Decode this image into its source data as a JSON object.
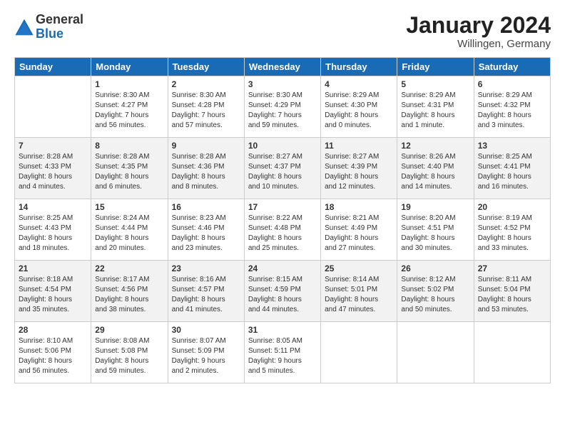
{
  "logo": {
    "general": "General",
    "blue": "Blue"
  },
  "header": {
    "title": "January 2024",
    "subtitle": "Willingen, Germany"
  },
  "days_of_week": [
    "Sunday",
    "Monday",
    "Tuesday",
    "Wednesday",
    "Thursday",
    "Friday",
    "Saturday"
  ],
  "weeks": [
    [
      {
        "day": "",
        "info": ""
      },
      {
        "day": "1",
        "info": "Sunrise: 8:30 AM\nSunset: 4:27 PM\nDaylight: 7 hours\nand 56 minutes."
      },
      {
        "day": "2",
        "info": "Sunrise: 8:30 AM\nSunset: 4:28 PM\nDaylight: 7 hours\nand 57 minutes."
      },
      {
        "day": "3",
        "info": "Sunrise: 8:30 AM\nSunset: 4:29 PM\nDaylight: 7 hours\nand 59 minutes."
      },
      {
        "day": "4",
        "info": "Sunrise: 8:29 AM\nSunset: 4:30 PM\nDaylight: 8 hours\nand 0 minutes."
      },
      {
        "day": "5",
        "info": "Sunrise: 8:29 AM\nSunset: 4:31 PM\nDaylight: 8 hours\nand 1 minute."
      },
      {
        "day": "6",
        "info": "Sunrise: 8:29 AM\nSunset: 4:32 PM\nDaylight: 8 hours\nand 3 minutes."
      }
    ],
    [
      {
        "day": "7",
        "info": "Sunrise: 8:28 AM\nSunset: 4:33 PM\nDaylight: 8 hours\nand 4 minutes."
      },
      {
        "day": "8",
        "info": "Sunrise: 8:28 AM\nSunset: 4:35 PM\nDaylight: 8 hours\nand 6 minutes."
      },
      {
        "day": "9",
        "info": "Sunrise: 8:28 AM\nSunset: 4:36 PM\nDaylight: 8 hours\nand 8 minutes."
      },
      {
        "day": "10",
        "info": "Sunrise: 8:27 AM\nSunset: 4:37 PM\nDaylight: 8 hours\nand 10 minutes."
      },
      {
        "day": "11",
        "info": "Sunrise: 8:27 AM\nSunset: 4:39 PM\nDaylight: 8 hours\nand 12 minutes."
      },
      {
        "day": "12",
        "info": "Sunrise: 8:26 AM\nSunset: 4:40 PM\nDaylight: 8 hours\nand 14 minutes."
      },
      {
        "day": "13",
        "info": "Sunrise: 8:25 AM\nSunset: 4:41 PM\nDaylight: 8 hours\nand 16 minutes."
      }
    ],
    [
      {
        "day": "14",
        "info": "Sunrise: 8:25 AM\nSunset: 4:43 PM\nDaylight: 8 hours\nand 18 minutes."
      },
      {
        "day": "15",
        "info": "Sunrise: 8:24 AM\nSunset: 4:44 PM\nDaylight: 8 hours\nand 20 minutes."
      },
      {
        "day": "16",
        "info": "Sunrise: 8:23 AM\nSunset: 4:46 PM\nDaylight: 8 hours\nand 23 minutes."
      },
      {
        "day": "17",
        "info": "Sunrise: 8:22 AM\nSunset: 4:48 PM\nDaylight: 8 hours\nand 25 minutes."
      },
      {
        "day": "18",
        "info": "Sunrise: 8:21 AM\nSunset: 4:49 PM\nDaylight: 8 hours\nand 27 minutes."
      },
      {
        "day": "19",
        "info": "Sunrise: 8:20 AM\nSunset: 4:51 PM\nDaylight: 8 hours\nand 30 minutes."
      },
      {
        "day": "20",
        "info": "Sunrise: 8:19 AM\nSunset: 4:52 PM\nDaylight: 8 hours\nand 33 minutes."
      }
    ],
    [
      {
        "day": "21",
        "info": "Sunrise: 8:18 AM\nSunset: 4:54 PM\nDaylight: 8 hours\nand 35 minutes."
      },
      {
        "day": "22",
        "info": "Sunrise: 8:17 AM\nSunset: 4:56 PM\nDaylight: 8 hours\nand 38 minutes."
      },
      {
        "day": "23",
        "info": "Sunrise: 8:16 AM\nSunset: 4:57 PM\nDaylight: 8 hours\nand 41 minutes."
      },
      {
        "day": "24",
        "info": "Sunrise: 8:15 AM\nSunset: 4:59 PM\nDaylight: 8 hours\nand 44 minutes."
      },
      {
        "day": "25",
        "info": "Sunrise: 8:14 AM\nSunset: 5:01 PM\nDaylight: 8 hours\nand 47 minutes."
      },
      {
        "day": "26",
        "info": "Sunrise: 8:12 AM\nSunset: 5:02 PM\nDaylight: 8 hours\nand 50 minutes."
      },
      {
        "day": "27",
        "info": "Sunrise: 8:11 AM\nSunset: 5:04 PM\nDaylight: 8 hours\nand 53 minutes."
      }
    ],
    [
      {
        "day": "28",
        "info": "Sunrise: 8:10 AM\nSunset: 5:06 PM\nDaylight: 8 hours\nand 56 minutes."
      },
      {
        "day": "29",
        "info": "Sunrise: 8:08 AM\nSunset: 5:08 PM\nDaylight: 8 hours\nand 59 minutes."
      },
      {
        "day": "30",
        "info": "Sunrise: 8:07 AM\nSunset: 5:09 PM\nDaylight: 9 hours\nand 2 minutes."
      },
      {
        "day": "31",
        "info": "Sunrise: 8:05 AM\nSunset: 5:11 PM\nDaylight: 9 hours\nand 5 minutes."
      },
      {
        "day": "",
        "info": ""
      },
      {
        "day": "",
        "info": ""
      },
      {
        "day": "",
        "info": ""
      }
    ]
  ]
}
